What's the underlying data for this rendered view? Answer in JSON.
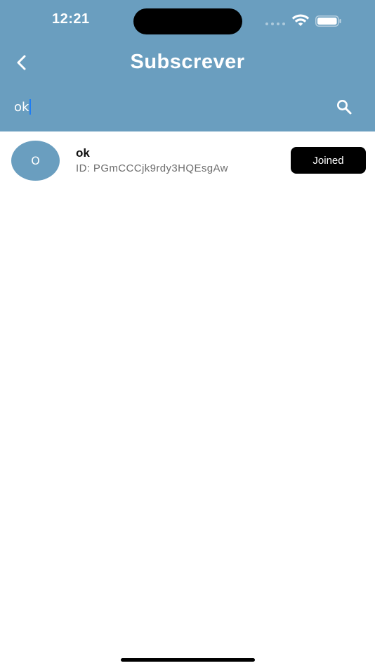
{
  "status_bar": {
    "time": "12:21"
  },
  "header": {
    "title": "Subscrever",
    "back_icon": "chevron-left-icon",
    "background_color": "#6a9ebf"
  },
  "search": {
    "value": "ok",
    "search_icon": "search-icon"
  },
  "results": [
    {
      "avatar_initial": "O",
      "name": "ok",
      "id_text": "ID: PGmCCCjk9rdy3HQEsgAw",
      "button_label": "Joined"
    }
  ],
  "colors": {
    "accent": "#6a9ebf",
    "button": "#000000",
    "caret": "#1e7cf5"
  }
}
